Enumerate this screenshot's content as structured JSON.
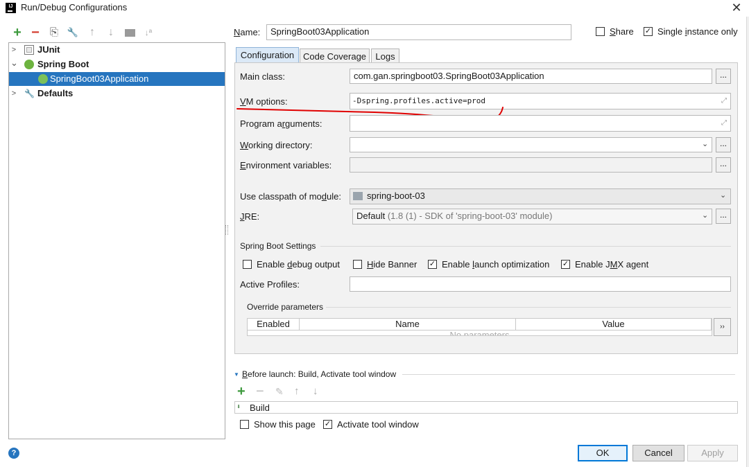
{
  "window": {
    "title": "Run/Debug Configurations",
    "icon_letter": "IJ",
    "close_glyph": "✕"
  },
  "left_toolbar": {
    "add": "+",
    "remove": "−",
    "copy": "⎘",
    "edit_defaults": "🔧",
    "move_up": "↑",
    "move_down": "↓",
    "folder": "▬",
    "sort": "↓ª"
  },
  "tree": {
    "items": [
      {
        "label": "JUnit",
        "expander": "›"
      },
      {
        "label": "Spring Boot",
        "expander": "⌄"
      },
      {
        "label": "SpringBoot03Application"
      },
      {
        "label": "Defaults",
        "expander": "›"
      }
    ]
  },
  "name": {
    "label_u": "N",
    "label_rest": "ame:",
    "value": "SpringBoot03Application"
  },
  "share": {
    "label_u": "S",
    "label_rest": "hare",
    "checked": false
  },
  "single_instance": {
    "label_pre": "Single ",
    "label_u": "i",
    "label_rest": "nstance only",
    "checked": true,
    "check": "✓"
  },
  "tabs": [
    "Configuration",
    "Code Coverage",
    "Logs"
  ],
  "form": {
    "main_class": {
      "label": "Main class:",
      "value": "com.gan.springboot03.SpringBoot03Application",
      "button": "..."
    },
    "vm_options": {
      "label_u": "V",
      "label_rest": "M options:",
      "value": "-Dspring.profiles.active=prod"
    },
    "program_arguments": {
      "label_pre": "Program a",
      "label_u": "r",
      "label_rest": "guments:",
      "value": ""
    },
    "working_directory": {
      "label_u": "W",
      "label_rest": "orking directory:",
      "value": "",
      "button": "..."
    },
    "environment_variables": {
      "label_u": "E",
      "label_rest": "nvironment variables:",
      "value": "",
      "button": "..."
    },
    "classpath_module": {
      "label_pre": "Use classpath of mo",
      "label_u": "d",
      "label_rest": "ule:",
      "value": "spring-boot-03"
    },
    "jre": {
      "label_u": "J",
      "label_rest": "RE:",
      "value": "Default",
      "value_detail": " (1.8 (1) - SDK of 'spring-boot-03' module)",
      "button": "..."
    }
  },
  "spring_boot_settings": {
    "title": "Spring Boot Settings",
    "debug_output": {
      "label_pre": "Enable ",
      "label_u": "d",
      "label_rest": "ebug output",
      "checked": false
    },
    "hide_banner": {
      "label_u": "H",
      "label_rest": "ide Banner",
      "checked": false
    },
    "launch_optimization": {
      "label_pre": "Enable ",
      "label_u": "l",
      "label_rest": "aunch optimization",
      "checked": true
    },
    "jmx_agent": {
      "label_pre": "Enable J",
      "label_u": "M",
      "label_rest": "X agent",
      "checked": true
    },
    "check": "✓",
    "active_profiles": {
      "label": "Active Profiles:",
      "value": ""
    }
  },
  "override": {
    "title": "Override parameters",
    "columns": [
      "Enabled",
      "Name",
      "Value"
    ],
    "empty_text": "No parameters",
    "side_button": "››"
  },
  "before_launch": {
    "arrow": "▼",
    "label_u": "B",
    "label_rest": "efore launch: Build, Activate tool window",
    "toolbar": {
      "add": "+",
      "remove": "−",
      "edit": "✎",
      "up": "↑",
      "down": "↓"
    },
    "items": [
      "Build"
    ],
    "show_page": {
      "label": "Show this page",
      "checked": false
    },
    "activate_window": {
      "label": "Activate tool window",
      "checked": true
    },
    "check": "✓"
  },
  "footer": {
    "help": "?",
    "ok": "OK",
    "cancel": "Cancel",
    "apply": "Apply"
  },
  "colors": {
    "selection": "#2675bf",
    "annotation_red": "#e00000",
    "add_green": "#3d9a3d",
    "remove_red": "#d33a2c"
  }
}
